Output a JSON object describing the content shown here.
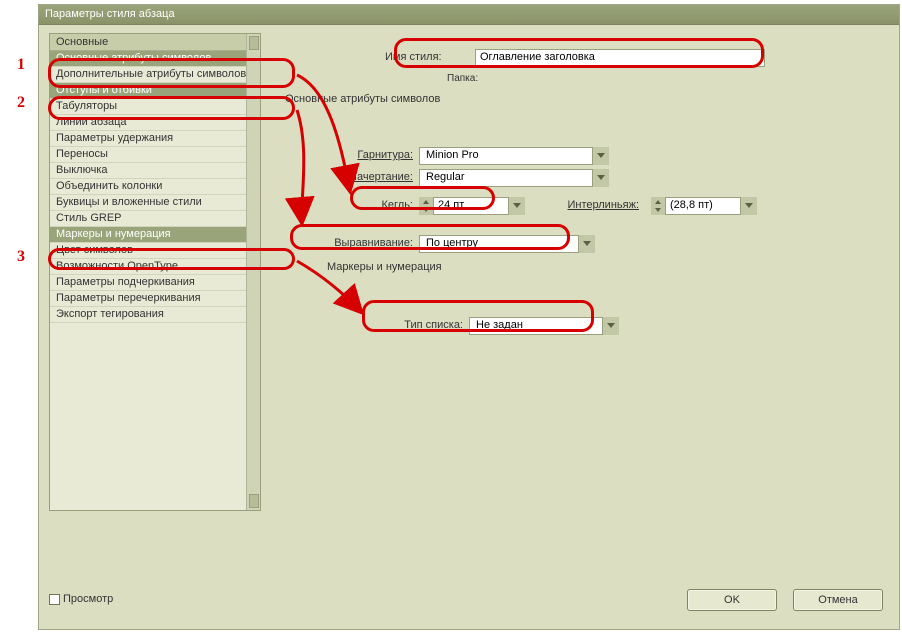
{
  "window": {
    "title": "Параметры стиля абзаца"
  },
  "annotations": {
    "n1": "1",
    "n2": "2",
    "n3": "3"
  },
  "sidebar": {
    "header": "Основные",
    "items": [
      "Основные атрибуты символов",
      "Дополнительные атрибуты символов",
      "Отступы и отбивки",
      "Табуляторы",
      "Линии абзаца",
      "Параметры удержания",
      "Переносы",
      "Выключка",
      "Объединить колонки",
      "Буквицы и вложенные стили",
      "Стиль GREP",
      "Маркеры и нумерация",
      "Цвет символов",
      "Возможности OpenType",
      "Параметры подчеркивания",
      "Параметры перечеркивания",
      "Экспорт тегирования"
    ]
  },
  "fields": {
    "style_name_label": "Имя стиля:",
    "style_name_value": "Оглавление заголовка",
    "folder_label": "Папка:",
    "section1_title": "Основные атрибуты символов",
    "font_label": "Гарнитура:",
    "font_value": "Minion Pro",
    "face_label": "Начертание:",
    "face_value": "Regular",
    "size_label": "Кегль:",
    "size_value": "24 пт",
    "leading_label": "Интерлиньяж:",
    "leading_value": "(28,8 пт)",
    "align_label": "Выравнивание:",
    "align_value": "По центру",
    "section2_title": "Маркеры и нумерация",
    "listtype_label": "Тип списка:",
    "listtype_value": "Не задан"
  },
  "footer": {
    "preview_label": "Просмотр",
    "ok": "OK",
    "cancel": "Отмена"
  }
}
